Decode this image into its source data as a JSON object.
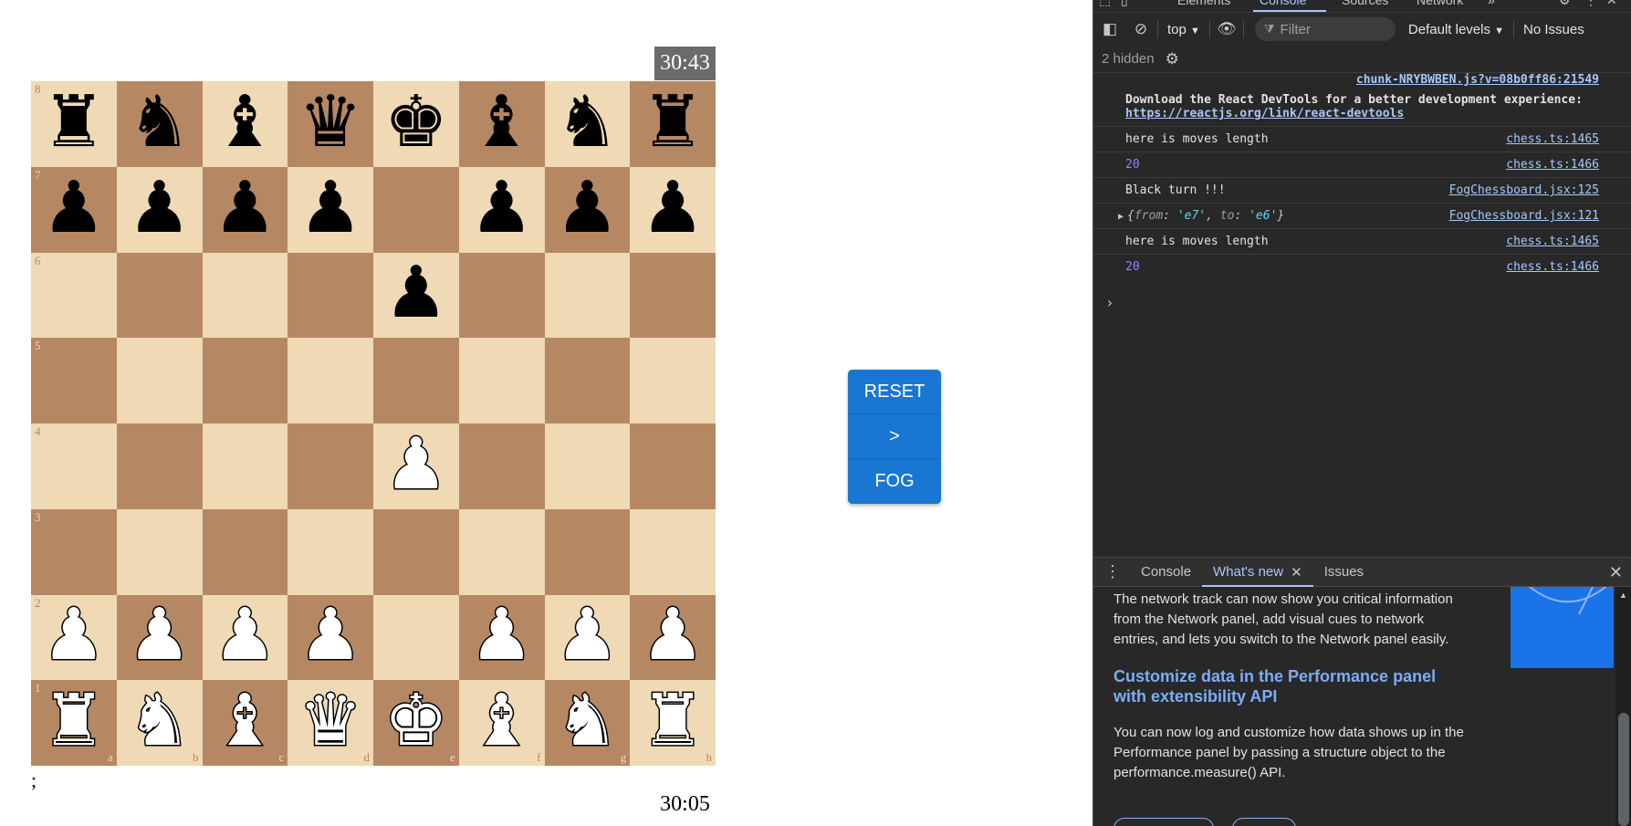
{
  "game": {
    "timer_top": "30:43",
    "timer_bottom": "30:05",
    "stray_text": ";",
    "ranks": [
      "8",
      "7",
      "6",
      "5",
      "4",
      "3",
      "2",
      "1"
    ],
    "files": [
      "a",
      "b",
      "c",
      "d",
      "e",
      "f",
      "g",
      "h"
    ],
    "board": [
      [
        "bR",
        "bN",
        "bB",
        "bQ",
        "bK",
        "bB",
        "bN",
        "bR"
      ],
      [
        "bP",
        "bP",
        "bP",
        "bP",
        "",
        "bP",
        "bP",
        "bP"
      ],
      [
        "",
        "",
        "",
        "",
        "bP",
        "",
        "",
        ""
      ],
      [
        "",
        "",
        "",
        "",
        "",
        "",
        "",
        ""
      ],
      [
        "",
        "",
        "",
        "",
        "wP",
        "",
        "",
        ""
      ],
      [
        "",
        "",
        "",
        "",
        "",
        "",
        "",
        ""
      ],
      [
        "wP",
        "wP",
        "wP",
        "wP",
        "",
        "wP",
        "wP",
        "wP"
      ],
      [
        "wR",
        "wN",
        "wB",
        "wQ",
        "wK",
        "wB",
        "wN",
        "wR"
      ]
    ],
    "colors": {
      "light_square": "#f0d9b5",
      "dark_square": "#b58863",
      "button": "#1976d2"
    }
  },
  "controls": {
    "reset_label": "RESET",
    "next_label": ">",
    "fog_label": "FOG"
  },
  "devtools": {
    "tabs": [
      "Elements",
      "Console",
      "Sources",
      "Network"
    ],
    "toolbar": {
      "context": "top",
      "filter_placeholder": "Filter",
      "levels": "Default levels",
      "issues": "No Issues"
    },
    "hidden_count": "2 hidden",
    "console": {
      "react_src": "chunk-NRYBWBEN.js?v=08b0ff86:21549",
      "react_msg": "Download the React DevTools for a better development experience: ",
      "react_link": "https://reactjs.org/link/react-devtools",
      "lines": [
        {
          "text": "here is moves length",
          "src": "chess.ts:1465"
        },
        {
          "text": "20",
          "src": "chess.ts:1466"
        },
        {
          "text": "Black turn !!!",
          "src": "FogChessboard.jsx:125"
        },
        {
          "text": "{from: 'e7', to: 'e6'}",
          "src": "FogChessboard.jsx:121"
        },
        {
          "text": "here is moves length",
          "src": "chess.ts:1465"
        },
        {
          "text": "20",
          "src": "chess.ts:1466"
        }
      ],
      "obj": {
        "from_key": "from",
        "from_val": "'e7'",
        "to_key": "to",
        "to_val": "'e6'"
      }
    },
    "drawer": {
      "tabs": [
        "Console",
        "What's new",
        "Issues"
      ],
      "whatsnew": {
        "para1": "The network track can now show you critical information from the Network panel, add visual cues to network entries, and lets you switch to the Network panel easily.",
        "heading": "Customize data in the Performance panel with extensibility API",
        "para2": "You can now log and customize how data shows up in the Performance panel by passing a structure object to the performance.measure() API."
      }
    }
  }
}
